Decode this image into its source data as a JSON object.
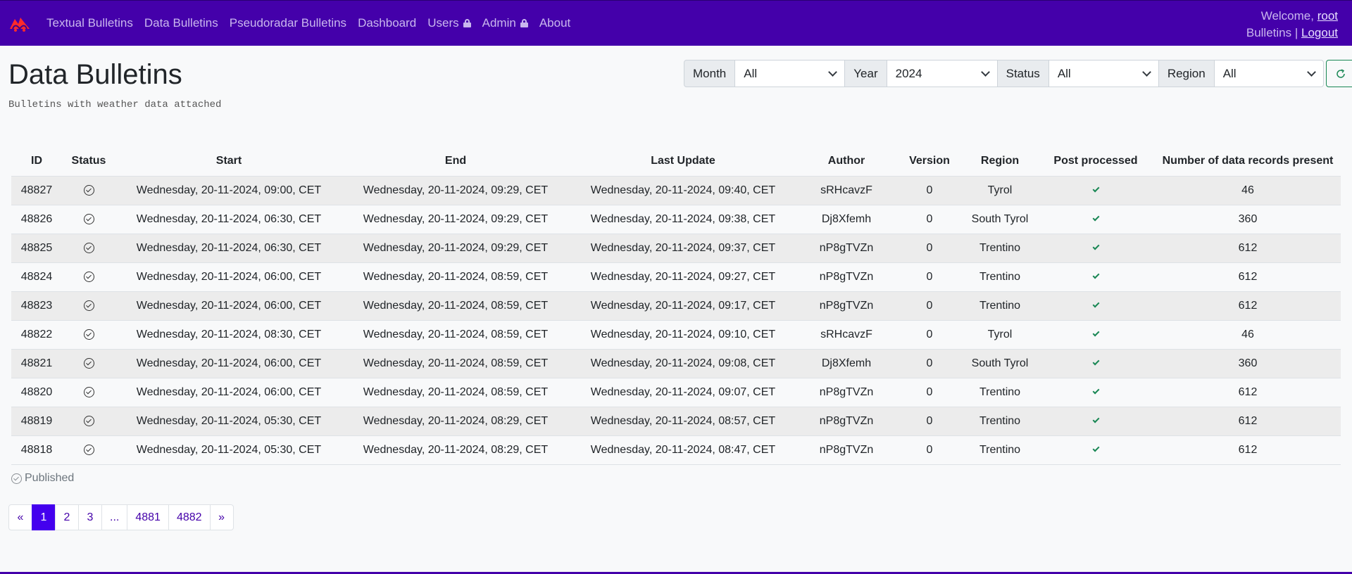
{
  "navbar": {
    "items": [
      {
        "label": "Textual Bulletins",
        "lock": false
      },
      {
        "label": "Data Bulletins",
        "lock": false
      },
      {
        "label": "Pseudoradar Bulletins",
        "lock": false
      },
      {
        "label": "Dashboard",
        "lock": false
      },
      {
        "label": "Users",
        "lock": true
      },
      {
        "label": "Admin",
        "lock": true
      },
      {
        "label": "About",
        "lock": false
      }
    ],
    "welcome": "Welcome,",
    "username": "root",
    "bulletins_label": "Bulletins |",
    "logout_label": "Logout"
  },
  "page": {
    "title": "Data Bulletins",
    "subtitle": "Bulletins with weather data attached"
  },
  "filters": [
    {
      "label": "Month",
      "value": "All"
    },
    {
      "label": "Year",
      "value": "2024"
    },
    {
      "label": "Status",
      "value": "All"
    },
    {
      "label": "Region",
      "value": "All"
    }
  ],
  "table": {
    "columns": [
      "ID",
      "Status",
      "Start",
      "End",
      "Last Update",
      "Author",
      "Version",
      "Region",
      "Post processed",
      "Number of data records present"
    ],
    "rows": [
      {
        "id": "48827",
        "start": "Wednesday, 20-11-2024, 09:00, CET",
        "end": "Wednesday, 20-11-2024, 09:29, CET",
        "updated": "Wednesday, 20-11-2024, 09:40, CET",
        "author": "sRHcavzF",
        "version": "0",
        "region": "Tyrol",
        "records": "46"
      },
      {
        "id": "48826",
        "start": "Wednesday, 20-11-2024, 06:30, CET",
        "end": "Wednesday, 20-11-2024, 09:29, CET",
        "updated": "Wednesday, 20-11-2024, 09:38, CET",
        "author": "Dj8Xfemh",
        "version": "0",
        "region": "South Tyrol",
        "records": "360"
      },
      {
        "id": "48825",
        "start": "Wednesday, 20-11-2024, 06:30, CET",
        "end": "Wednesday, 20-11-2024, 09:29, CET",
        "updated": "Wednesday, 20-11-2024, 09:37, CET",
        "author": "nP8gTVZn",
        "version": "0",
        "region": "Trentino",
        "records": "612"
      },
      {
        "id": "48824",
        "start": "Wednesday, 20-11-2024, 06:00, CET",
        "end": "Wednesday, 20-11-2024, 08:59, CET",
        "updated": "Wednesday, 20-11-2024, 09:27, CET",
        "author": "nP8gTVZn",
        "version": "0",
        "region": "Trentino",
        "records": "612"
      },
      {
        "id": "48823",
        "start": "Wednesday, 20-11-2024, 06:00, CET",
        "end": "Wednesday, 20-11-2024, 08:59, CET",
        "updated": "Wednesday, 20-11-2024, 09:17, CET",
        "author": "nP8gTVZn",
        "version": "0",
        "region": "Trentino",
        "records": "612"
      },
      {
        "id": "48822",
        "start": "Wednesday, 20-11-2024, 08:30, CET",
        "end": "Wednesday, 20-11-2024, 08:59, CET",
        "updated": "Wednesday, 20-11-2024, 09:10, CET",
        "author": "sRHcavzF",
        "version": "0",
        "region": "Tyrol",
        "records": "46"
      },
      {
        "id": "48821",
        "start": "Wednesday, 20-11-2024, 06:00, CET",
        "end": "Wednesday, 20-11-2024, 08:59, CET",
        "updated": "Wednesday, 20-11-2024, 09:08, CET",
        "author": "Dj8Xfemh",
        "version": "0",
        "region": "South Tyrol",
        "records": "360"
      },
      {
        "id": "48820",
        "start": "Wednesday, 20-11-2024, 06:00, CET",
        "end": "Wednesday, 20-11-2024, 08:59, CET",
        "updated": "Wednesday, 20-11-2024, 09:07, CET",
        "author": "nP8gTVZn",
        "version": "0",
        "region": "Trentino",
        "records": "612"
      },
      {
        "id": "48819",
        "start": "Wednesday, 20-11-2024, 05:30, CET",
        "end": "Wednesday, 20-11-2024, 08:29, CET",
        "updated": "Wednesday, 20-11-2024, 08:57, CET",
        "author": "nP8gTVZn",
        "version": "0",
        "region": "Trentino",
        "records": "612"
      },
      {
        "id": "48818",
        "start": "Wednesday, 20-11-2024, 05:30, CET",
        "end": "Wednesday, 20-11-2024, 08:29, CET",
        "updated": "Wednesday, 20-11-2024, 08:47, CET",
        "author": "nP8gTVZn",
        "version": "0",
        "region": "Trentino",
        "records": "612"
      }
    ]
  },
  "legend": {
    "published_label": "Published"
  },
  "pagination": {
    "prev": "«",
    "pages": [
      "1",
      "2",
      "3",
      "...",
      "4881",
      "4882"
    ],
    "active": "1",
    "next": "»"
  },
  "colors": {
    "navbar_bg": "#4400aa",
    "accent": "#4400ee",
    "success": "#198754"
  }
}
